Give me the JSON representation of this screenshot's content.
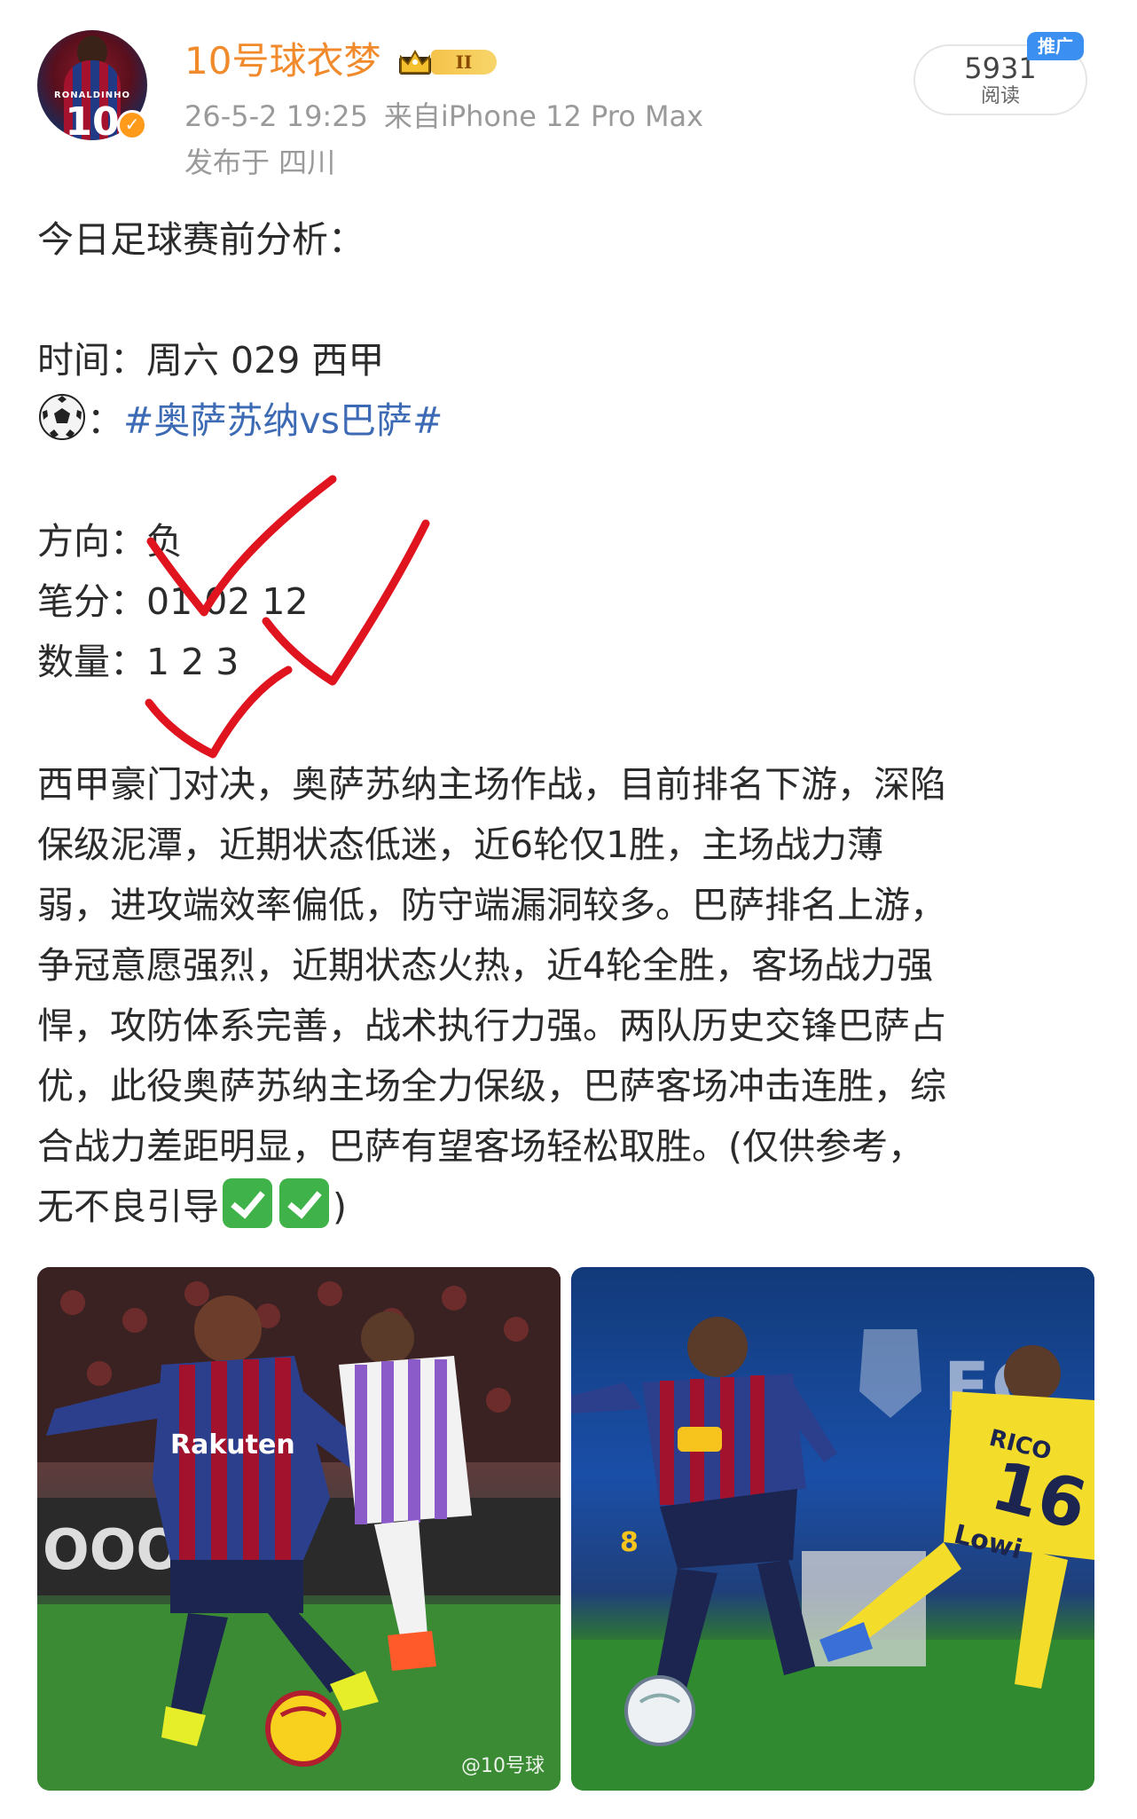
{
  "header": {
    "username": "10号球衣梦",
    "rank_badge": "II",
    "timestamp": "26-5-2 19:25",
    "source": "来自iPhone 12 Pro Max",
    "location": "发布于 四川",
    "views_count": "5931",
    "views_label": "阅读",
    "promo_label": "推广"
  },
  "avatar": {
    "jersey_name": "RONALDINHO",
    "jersey_number": "10"
  },
  "post": {
    "intro": "今日足球赛前分析：",
    "time_label": "时间：",
    "time_value": "周六 029 西甲",
    "ball_sep": "：",
    "hashtag": "#奥萨苏纳vs巴萨#",
    "direction_label": "方向：",
    "direction_value": "负",
    "score_label": "笔分：",
    "score_value": "01 02 12",
    "count_label": "数量：",
    "count_value": "1 2 3",
    "paragraph_lines": [
      "西甲豪门对决，奥萨苏纳主场作战，目前排名下游，深陷",
      "保级泥潭，近期状态低迷，近6轮仅1胜，主场战力薄",
      "弱，进攻端效率偏低，防守端漏洞较多。巴萨排名上游，",
      "争冠意愿强烈，近期状态火热，近4轮全胜，客场战力强",
      "悍，攻防体系完善，战术执行力强。两队历史交锋巴萨占",
      "优，此役奥萨苏纳主场全力保级，巴萨客场冲击连胜，综",
      "合战力差距明显，巴萨有望客场轻松取胜。(仅供参考，"
    ],
    "last_line_text": "无不良引导",
    "last_line_close": ")"
  },
  "photos": {
    "left_jersey_sponsor": "Rakuten",
    "right_banner": "FC BA",
    "right_jersey_name": "RICO",
    "right_jersey_number": "16",
    "right_jersey_sponsor": "Lowi",
    "right_player_number": "8",
    "watermark": "@10号球"
  },
  "colors": {
    "username": "#f08a2b",
    "hashtag": "#3d6ab4",
    "meta": "#9a9a9a",
    "promo": "#3a8ff0",
    "red_check": "#e0141e"
  },
  "icons": [
    "verified-badge-icon",
    "crown-icon",
    "soccer-ball-icon",
    "check-mark-emoji-icon"
  ]
}
